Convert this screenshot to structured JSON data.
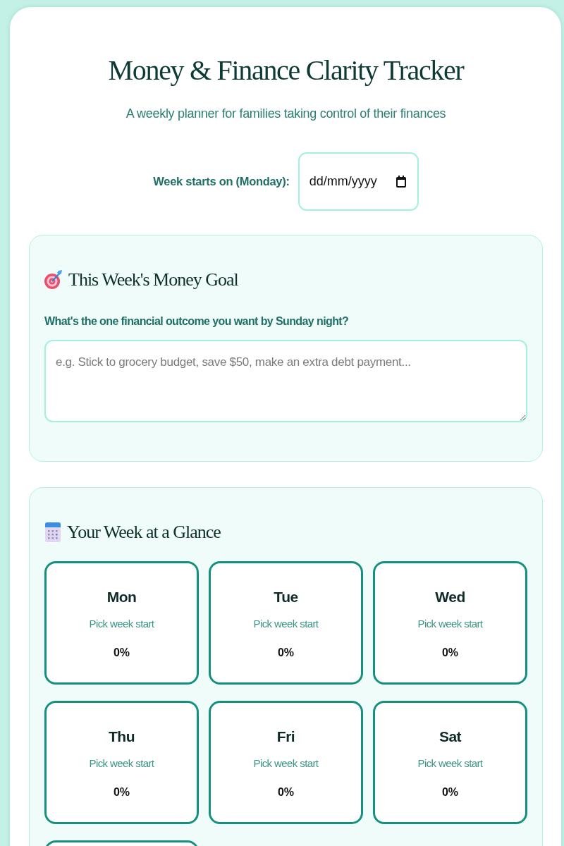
{
  "title": "Money & Finance Clarity Tracker",
  "subtitle": "A weekly planner for families taking control of their finances",
  "week_start": {
    "label": "Week starts on (Monday):",
    "placeholder": "dd/mm/yyyy"
  },
  "goal_section": {
    "heading": "This Week's Money Goal",
    "question": "What's the one financial outcome you want by Sunday night?",
    "placeholder": "e.g. Stick to grocery budget, save $50, make an extra debt payment..."
  },
  "week_section": {
    "heading": "Your Week at a Glance",
    "days": [
      {
        "kind": "day",
        "name": "Mon",
        "status": "Pick week start",
        "percent": "0%"
      },
      {
        "kind": "day",
        "name": "Tue",
        "status": "Pick week start",
        "percent": "0%"
      },
      {
        "kind": "day",
        "name": "Wed",
        "status": "Pick week start",
        "percent": "0%"
      },
      {
        "kind": "day",
        "name": "Thu",
        "status": "Pick week start",
        "percent": "0%"
      },
      {
        "kind": "day",
        "name": "Fri",
        "status": "Pick week start",
        "percent": "0%"
      },
      {
        "kind": "day",
        "name": "Sat",
        "status": "Pick week start",
        "percent": "0%"
      },
      {
        "kind": "cut_off"
      }
    ]
  }
}
